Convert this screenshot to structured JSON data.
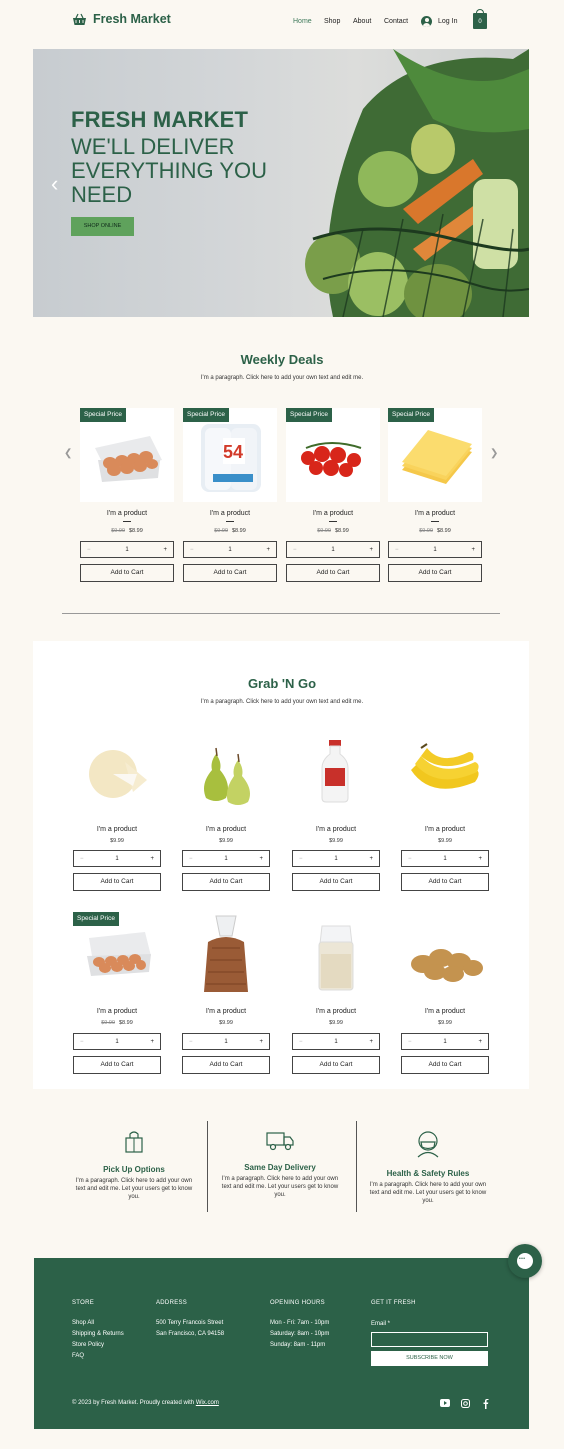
{
  "header": {
    "brand": "Fresh Market",
    "nav": [
      "Home",
      "Shop",
      "About",
      "Contact"
    ],
    "login": "Log In",
    "cart_count": "0"
  },
  "hero": {
    "title": "FRESH MARKET",
    "subtitle": "WE'LL DELIVER EVERYTHING YOU NEED",
    "button": "SHOP ONLINE"
  },
  "weekly": {
    "title": "Weekly Deals",
    "para": "I'm a paragraph. Click here to add your own text and edit me.",
    "badge": "Special Price",
    "products": [
      {
        "name": "I'm a product",
        "old": "$9.99",
        "price": "$8.99",
        "qty": "1",
        "cta": "Add to Cart",
        "img": "eggs"
      },
      {
        "name": "I'm a product",
        "old": "$9.99",
        "price": "$8.99",
        "qty": "1",
        "cta": "Add to Cart",
        "img": "paper-towels"
      },
      {
        "name": "I'm a product",
        "old": "$9.99",
        "price": "$8.99",
        "qty": "1",
        "cta": "Add to Cart",
        "img": "tomatoes"
      },
      {
        "name": "I'm a product",
        "old": "$9.99",
        "price": "$8.99",
        "qty": "1",
        "cta": "Add to Cart",
        "img": "cheese"
      }
    ]
  },
  "grab": {
    "title": "Grab 'N Go",
    "para": "I'm a paragraph. Click here to add your own text and edit me.",
    "badge": "Special Price",
    "products": [
      {
        "name": "I'm a product",
        "price": "$9.99",
        "qty": "1",
        "cta": "Add to Cart",
        "img": "brie"
      },
      {
        "name": "I'm a product",
        "price": "$9.99",
        "qty": "1",
        "cta": "Add to Cart",
        "img": "pears"
      },
      {
        "name": "I'm a product",
        "price": "$9.99",
        "qty": "1",
        "cta": "Add to Cart",
        "img": "milk"
      },
      {
        "name": "I'm a product",
        "price": "$9.99",
        "qty": "1",
        "cta": "Add to Cart",
        "img": "bananas"
      },
      {
        "name": "I'm a product",
        "old": "$9.99",
        "price": "$8.99",
        "qty": "1",
        "cta": "Add to Cart",
        "img": "eggs"
      },
      {
        "name": "I'm a product",
        "price": "$9.99",
        "qty": "1",
        "cta": "Add to Cart",
        "img": "bread"
      },
      {
        "name": "I'm a product",
        "price": "$9.99",
        "qty": "1",
        "cta": "Add to Cart",
        "img": "rice"
      },
      {
        "name": "I'm a product",
        "price": "$9.99",
        "qty": "1",
        "cta": "Add to Cart",
        "img": "potatoes"
      }
    ]
  },
  "features": [
    {
      "title": "Pick Up Options",
      "text": "I'm a paragraph. Click here to add your own text and edit me. Let your users get to know you.",
      "icon": "bag-icon"
    },
    {
      "title": "Same Day Delivery",
      "text": "I'm a paragraph. Click here to add your own text and edit me. Let your users get to know you.",
      "icon": "truck-icon"
    },
    {
      "title": "Health & Safety Rules",
      "text": "I'm a paragraph. Click here to add your own text and edit me. Let your users get to know you.",
      "icon": "mask-icon"
    }
  ],
  "footer": {
    "store_title": "STORE",
    "store_links": [
      "Shop All",
      "Shipping & Returns",
      "Store Policy",
      "FAQ"
    ],
    "address_title": "ADDRESS",
    "address": [
      "500 Terry Francois Street",
      "San Francisco, CA 94158"
    ],
    "hours_title": "OPENING HOURS",
    "hours": [
      "Mon - Fri: 7am - 10pm",
      "Saturday: 8am - 10pm",
      "Sunday: 8am - 11pm"
    ],
    "fresh_title": "GET IT FRESH",
    "email_label": "Email *",
    "subscribe": "SUBSCRIBE NOW",
    "copyright_pre": "© 2023 by Fresh Market. Proudly created with ",
    "copyright_link": "Wix.com"
  },
  "colors": {
    "brand": "#2c6148",
    "accent": "#5fa25c",
    "background": "#fbf8f2"
  }
}
